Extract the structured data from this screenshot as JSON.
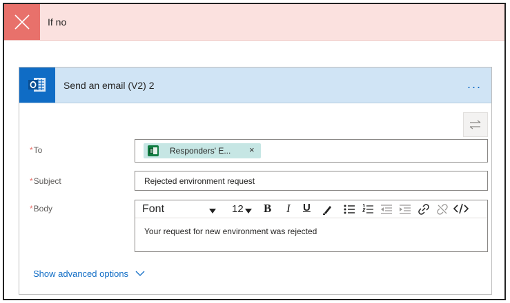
{
  "condition": {
    "title": "If no",
    "close_icon": "close-icon"
  },
  "action": {
    "title": "Send an email (V2) 2",
    "more_label": "...",
    "icon": "outlook-icon"
  },
  "fields": {
    "to": {
      "label": "To",
      "token": "Responders' E...",
      "token_remove": "×"
    },
    "subject": {
      "label": "Subject",
      "value": "Rejected environment request"
    },
    "body": {
      "label": "Body",
      "font": "Font",
      "font_size": "12",
      "bold": "B",
      "italic": "I",
      "underline": "U",
      "value": "Your request for new environment was rejected"
    }
  },
  "advanced_label": "Show advanced options",
  "required_marker": "*",
  "colors": {
    "accent": "#0f6cc5",
    "error_bg": "#fbe1df",
    "error_accent": "#e8716b",
    "header_bg": "#d0e4f5"
  }
}
